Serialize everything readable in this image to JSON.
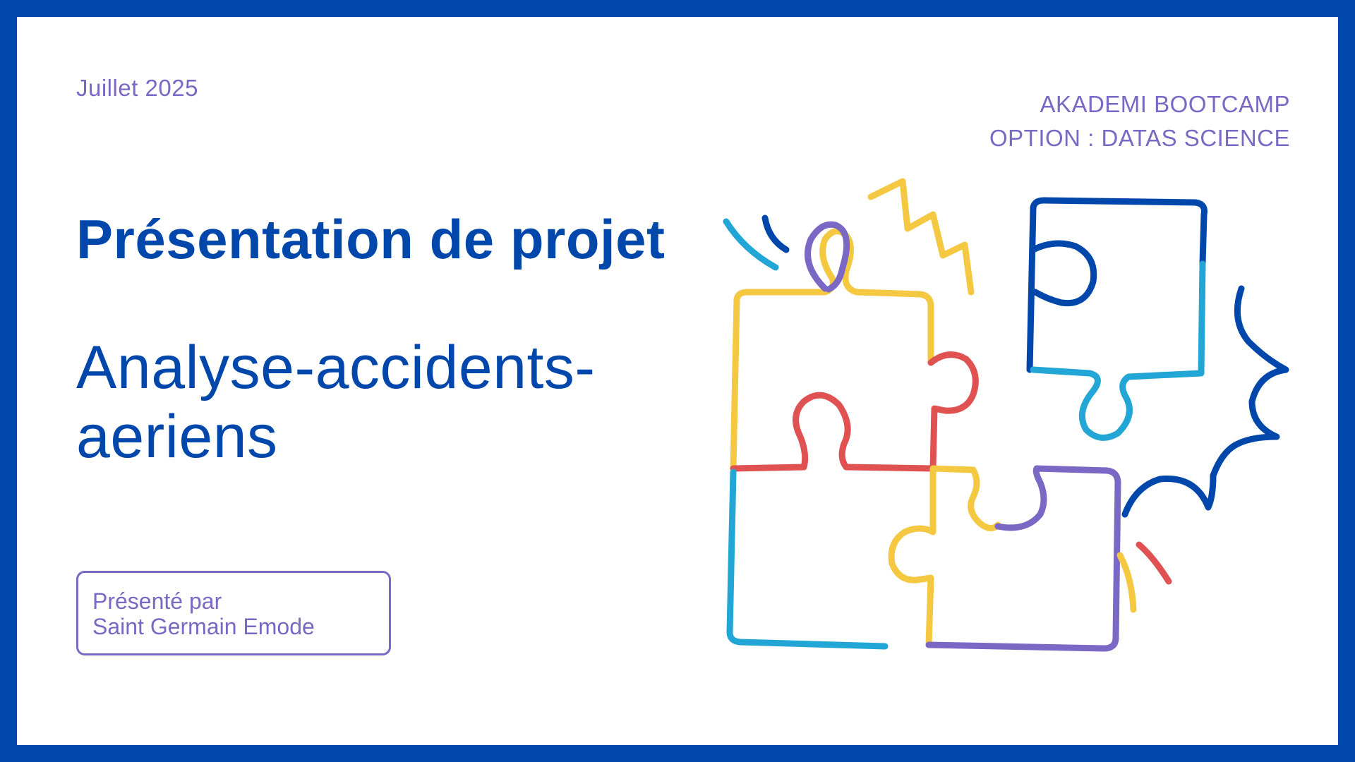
{
  "slide": {
    "date": "Juillet 2025",
    "org_line1": "AKADEMI BOOTCAMP",
    "org_line2": "OPTION : DATAS SCIENCE",
    "title": "Présentation de projet",
    "subtitle": "Analyse-accidents-aeriens",
    "presenter_label": "Présenté par",
    "presenter_name": "Saint Germain Emode"
  },
  "illustration": {
    "name": "puzzle-pieces-illustration",
    "colors": {
      "navy": "#0047ab",
      "cyan": "#22a6d6",
      "yellow": "#f5c842",
      "red": "#e05252",
      "purple": "#7a68c4"
    }
  },
  "theme": {
    "border": "#0047ab",
    "primary": "#0047ab",
    "secondary": "#7a68c4",
    "background": "#ffffff"
  }
}
